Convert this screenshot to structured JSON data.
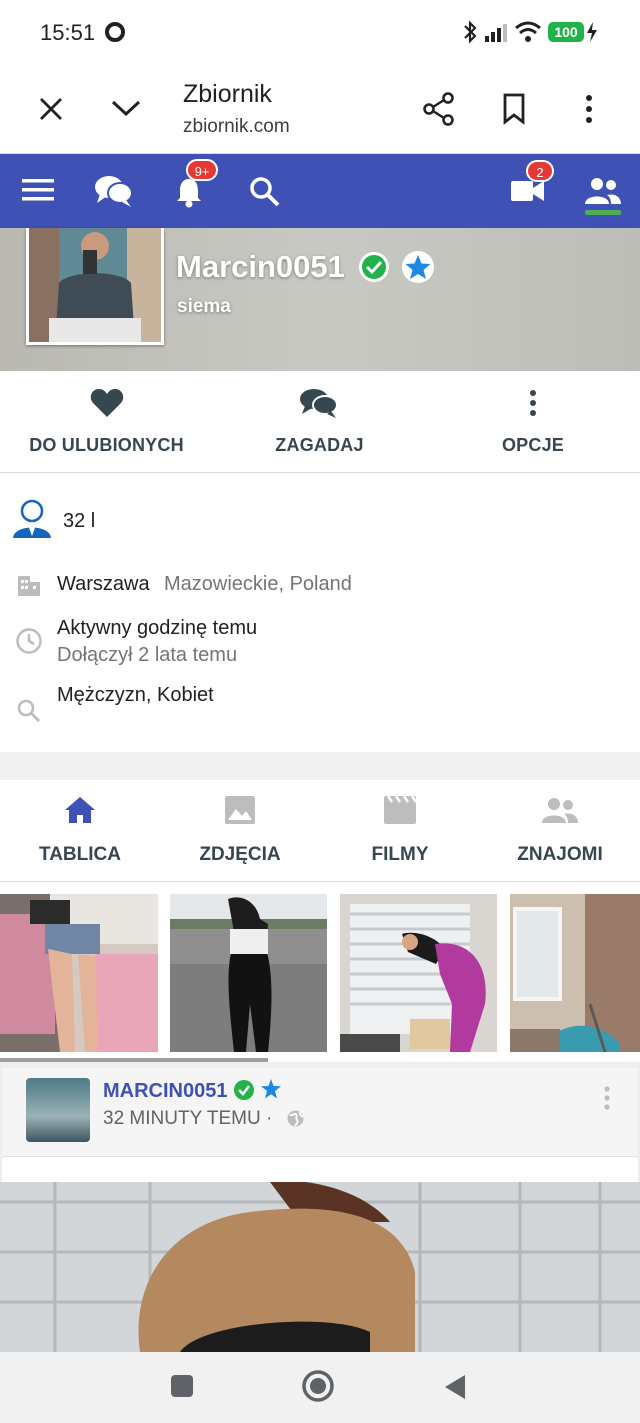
{
  "status_bar": {
    "time": "15:51",
    "battery": "100"
  },
  "browser_toolbar": {
    "title": "Zbiornik",
    "url": "zbiornik.com"
  },
  "site_header": {
    "notifications_badge": "9+",
    "video_badge": "2"
  },
  "profile": {
    "username": "Marcin0051",
    "status": "siema",
    "age": "32 l",
    "city": "Warszawa",
    "region": "Mazowieckie, Poland",
    "last_active": "Aktywny godzinę temu",
    "joined": "Dołączył 2 lata temu",
    "looking_for": "Mężczyzn, Kobiet"
  },
  "actions": {
    "favorite": "DO ULUBIONYCH",
    "ask": "ZAGADAJ",
    "options": "OPCJE"
  },
  "tabs": {
    "board": "TABLICA",
    "photos": "ZDJĘCIA",
    "videos": "FILMY",
    "friends": "ZNAJOMI"
  },
  "post": {
    "author": "MARCIN0051",
    "time": "32 MINUTY TEMU ·"
  },
  "colors": {
    "brand": "#3f51b5",
    "badge": "#e53935",
    "verified": "#21b24a",
    "star": "#1e88e5"
  }
}
